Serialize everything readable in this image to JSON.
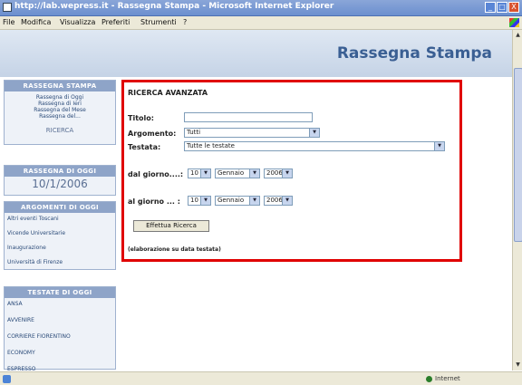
{
  "window": {
    "title": "http://lab.wepress.it - Rassegna Stampa - Microsoft Internet Explorer",
    "min_glyph": "_",
    "max_glyph": "□",
    "close_glyph": "X"
  },
  "menu": {
    "items": [
      "File",
      "Modifica",
      "Visualizza",
      "Preferiti",
      "Strumenti",
      "?"
    ]
  },
  "banner": {
    "title": "Rassegna Stampa"
  },
  "sidebar": {
    "rassegna": {
      "heading": "RASSEGNA STAMPA",
      "lines": [
        "Rassegna di Oggi",
        "Rassegna di Ieri",
        "Rassegna del Mese",
        "Rassegna del..."
      ],
      "ricerca": "RICERCA"
    },
    "oggi": {
      "heading": "RASSEGNA DI OGGI",
      "date": "10/1/2006"
    },
    "argomenti": {
      "heading": "ARGOMENTI DI OGGI",
      "items": [
        "Altri eventi Toscani",
        "Vicende Universitarie",
        "Inaugurazione",
        "Università di Firenze"
      ]
    },
    "testate": {
      "heading": "TESTATE DI OGGI",
      "items": [
        "ANSA",
        "AVVENIRE",
        "CORRIERE FIORENTINO",
        "ECONOMY",
        "ESPRESSO"
      ]
    }
  },
  "form": {
    "heading": "RICERCA AVANZATA",
    "titolo_label": "Titolo:",
    "titolo_value": "",
    "argomento_label": "Argomento:",
    "argomento_value": "Tutti",
    "testata_label": "Testata:",
    "testata_value": "Tutte le testate",
    "dal_label": "dal giorno....:",
    "al_label": "al giorno ... :",
    "dal_day": "10",
    "dal_month": "Gennaio",
    "dal_year": "2006",
    "al_day": "10",
    "al_month": "Gennaio",
    "al_year": "2006",
    "submit": "Effettua Ricerca",
    "note": "(elaborazione su data testata)"
  },
  "status": {
    "zone": "Internet"
  }
}
